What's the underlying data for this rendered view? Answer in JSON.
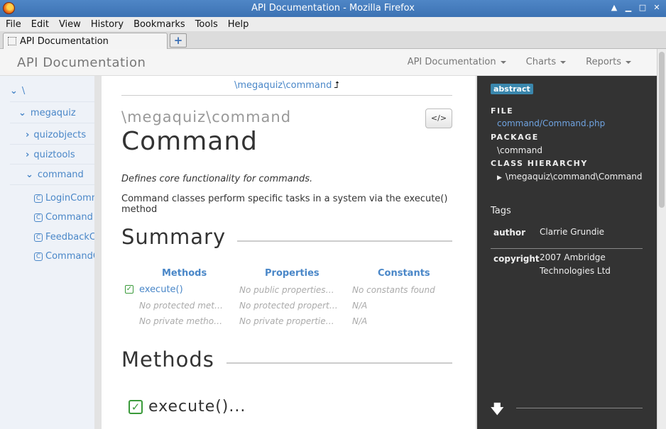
{
  "window": {
    "title": "API Documentation - Mozilla Firefox",
    "controls": [
      "▲",
      "▁",
      "□",
      "✕"
    ]
  },
  "menubar": [
    "File",
    "Edit",
    "View",
    "History",
    "Bookmarks",
    "Tools",
    "Help"
  ],
  "tab": {
    "label": "API Documentation",
    "new_tab": "+"
  },
  "navbar": {
    "brand": "API Documentation",
    "items": [
      "API Documentation",
      "Charts",
      "Reports"
    ]
  },
  "sidebar": {
    "root": "\\",
    "package": "megaquiz",
    "subpackages": [
      "quizobjects",
      "quiztools",
      "command"
    ],
    "classes": [
      "LoginCommand",
      "Command",
      "FeedbackCommand",
      "CommandContext"
    ]
  },
  "main": {
    "breadcrumb": "\\megaquiz\\command",
    "breadcrumb_up": "⮥",
    "namespace": "\\megaquiz\\command",
    "class_name": "Command",
    "source_button": "</>",
    "short_description": "Defines core functionality for commands.",
    "long_description": "Command classes perform specific tasks in a system via the execute() method",
    "summary_heading": "Summary",
    "summary": {
      "columns": [
        "Methods",
        "Properties",
        "Constants"
      ],
      "rows": [
        [
          "execute()",
          "No public properties found",
          "No constants found"
        ],
        [
          "No protected methods found",
          "No protected properties found",
          "N/A"
        ],
        [
          "No private methods found",
          "No private properties found",
          "N/A"
        ]
      ]
    },
    "methods_heading": "Methods",
    "method_name": "execute()..."
  },
  "right_panel": {
    "badge": "abstract",
    "file_label": "FILE",
    "file_value": "command/Command.php",
    "package_label": "PACKAGE",
    "package_value": "\\command",
    "hierarchy_label": "CLASS HIERARCHY",
    "hierarchy_value": "\\megaquiz\\command\\Command",
    "tags_heading": "Tags",
    "tags": [
      {
        "key": "author",
        "value": "Clarrie Grundie"
      },
      {
        "key": "copyright",
        "value": "2007 Ambridge Technologies Ltd"
      }
    ]
  },
  "colors": {
    "titlebar": "#3c72b3",
    "link": "#4a87c8",
    "right_panel_bg": "#333333",
    "badge": "#3a87ad",
    "check": "#3a9a3a"
  },
  "icons": [
    "firefox-logo",
    "page-icon",
    "chevron-down-icon",
    "chevron-right-icon",
    "class-icon",
    "source-code-icon",
    "check-icon",
    "triangle-right-icon",
    "down-arrow-icon"
  ]
}
